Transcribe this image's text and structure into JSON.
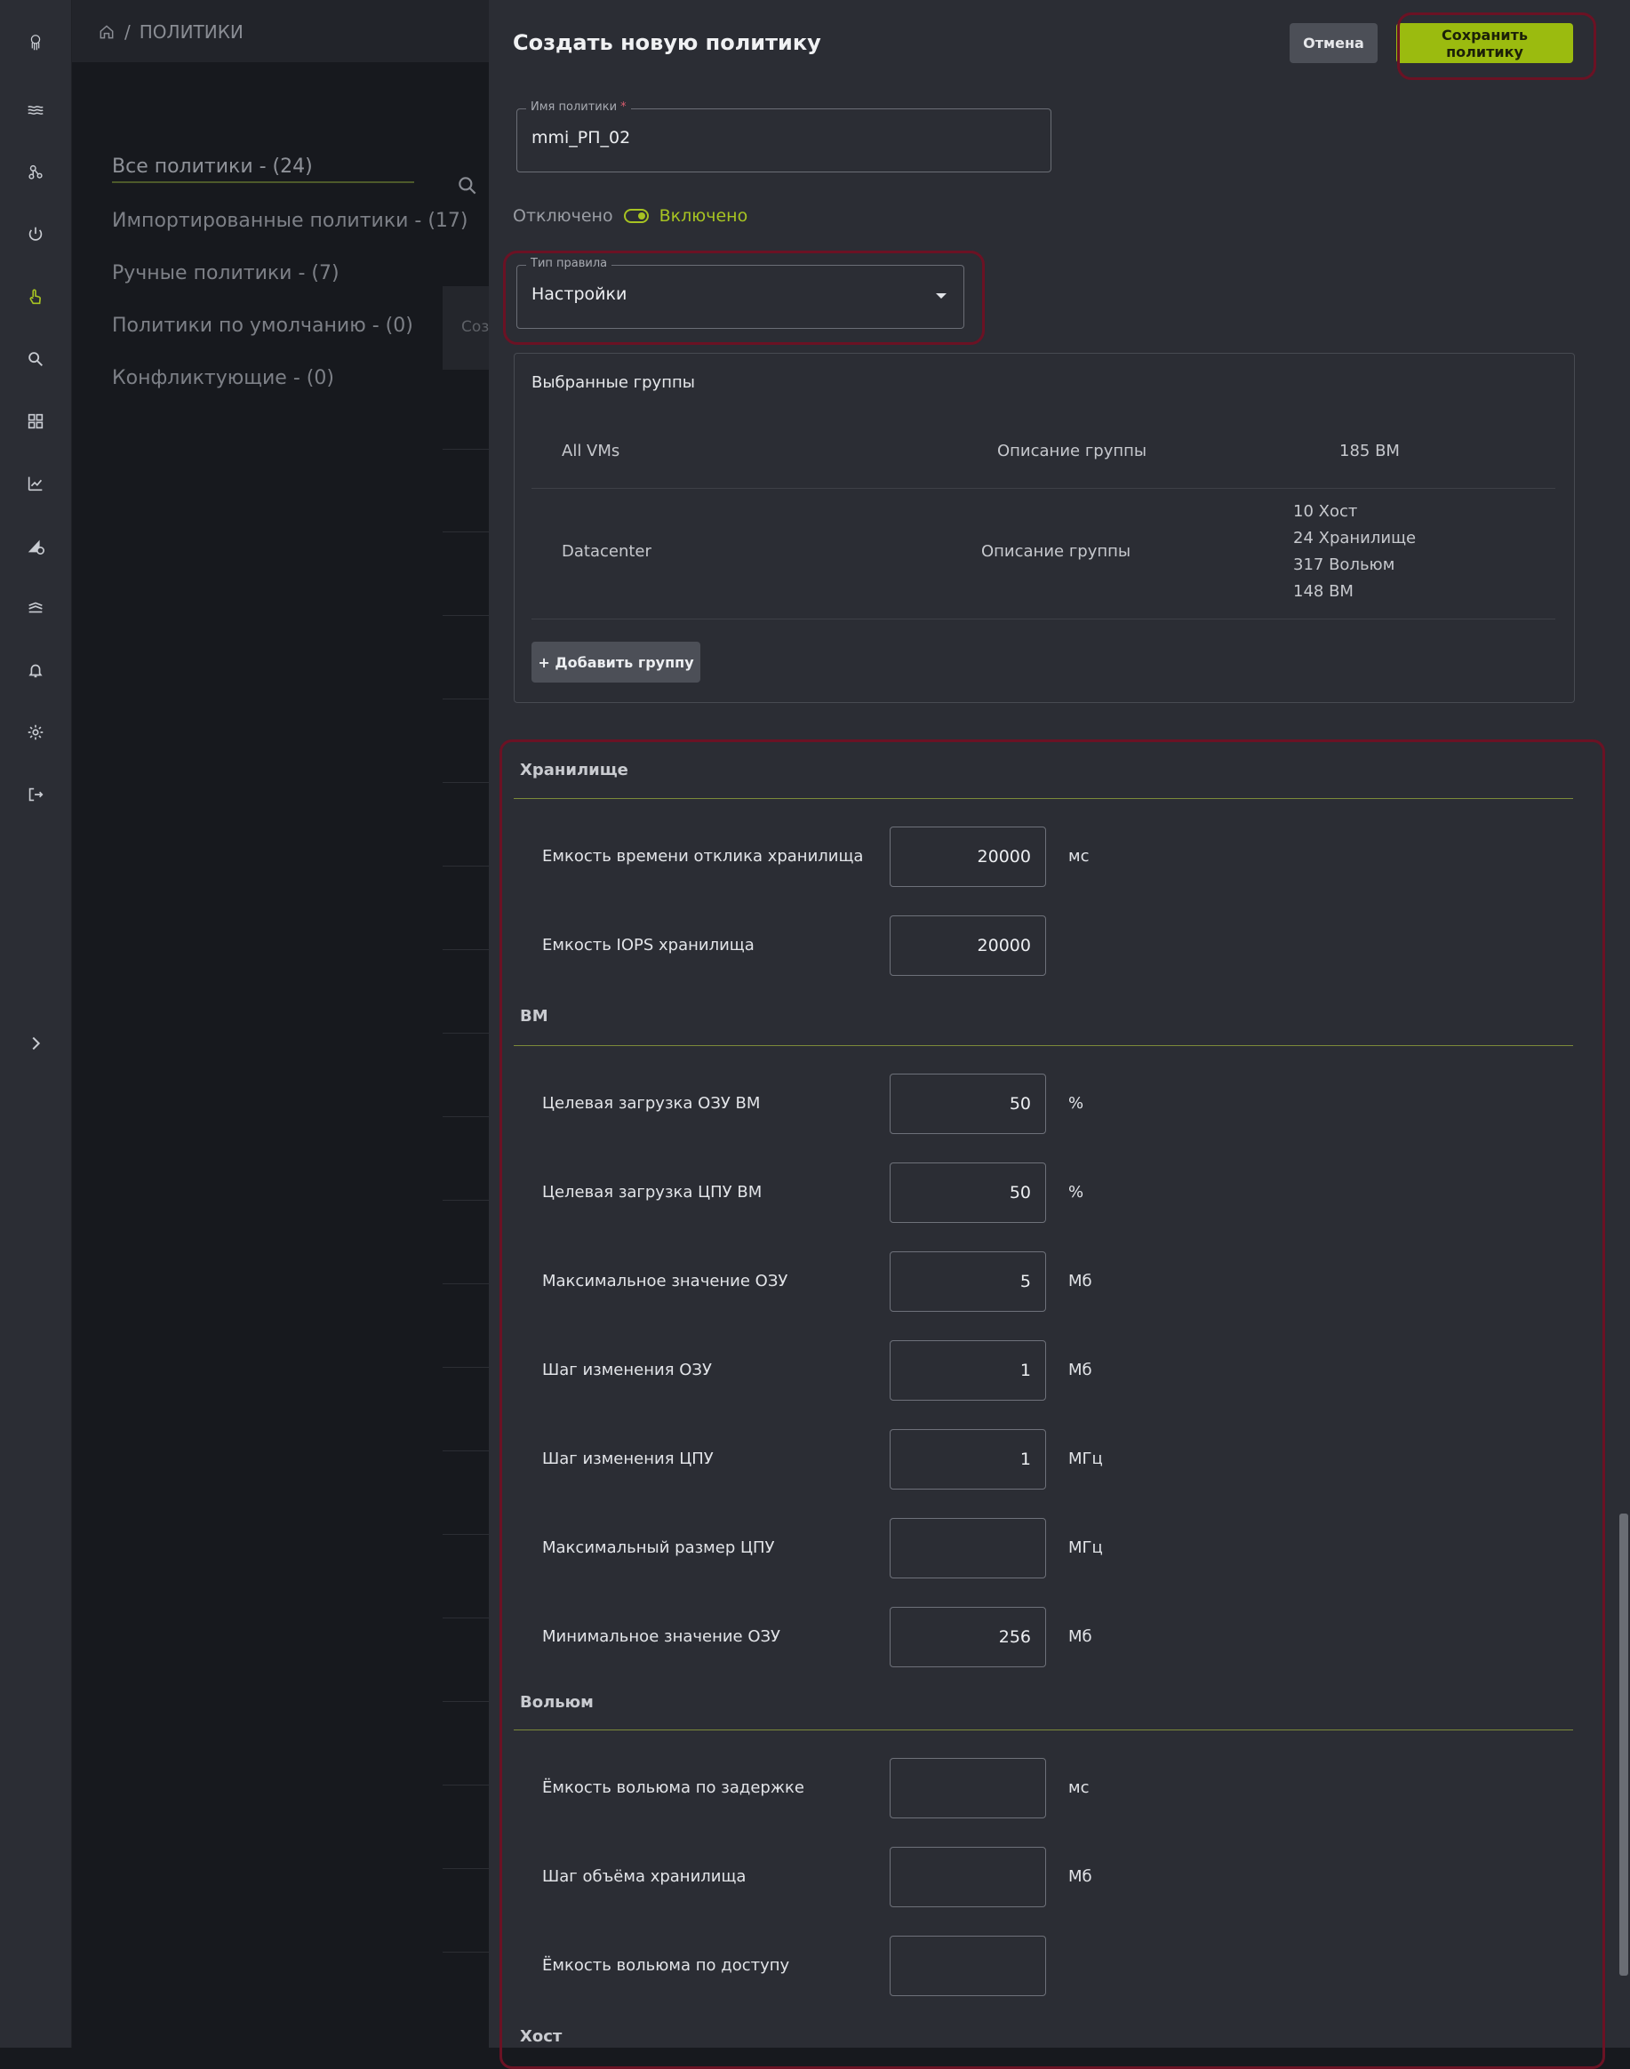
{
  "breadcrumb": {
    "page": "ПОЛИТИКИ"
  },
  "filters": [
    "Все политики - (24)",
    "Импортированные политики - (17)",
    "Ручные политики - (7)",
    "Политики по умолчанию - (0)",
    "Конфликтующие - (0)"
  ],
  "background_table": {
    "header_fragment": "Соз"
  },
  "drawer": {
    "title": "Создать новую политику",
    "cancel_label": "Отмена",
    "save_label": "Сохранить политику",
    "policy_name": {
      "label": "Имя политики",
      "required_mark": "*",
      "value": "mmi_РП_02"
    },
    "toggle": {
      "off_label": "Отключено",
      "on_label": "Включено",
      "state": "on"
    },
    "rule_type": {
      "label": "Тип правила",
      "value": "Настройки"
    },
    "groups": {
      "title": "Выбранные группы",
      "rows": [
        {
          "name": "All VMs",
          "description": "Описание группы",
          "counts": [
            "185 ВМ"
          ]
        },
        {
          "name": "Datacenter",
          "description": "Описание группы",
          "counts": [
            "10 Хост",
            "24 Хранилище",
            "317 Вольюм",
            "148 ВМ"
          ]
        }
      ],
      "add_label": "+ Добавить группу"
    },
    "sections": [
      {
        "title": "Хранилище",
        "params": [
          {
            "label": "Емкость времени отклика хранилища",
            "value": "20000",
            "unit": "мс"
          },
          {
            "label": "Емкость IOPS хранилища",
            "value": "20000",
            "unit": ""
          }
        ]
      },
      {
        "title": "ВМ",
        "params": [
          {
            "label": "Целевая загрузка ОЗУ ВМ",
            "value": "50",
            "unit": "%"
          },
          {
            "label": "Целевая загрузка ЦПУ ВМ",
            "value": "50",
            "unit": "%"
          },
          {
            "label": "Максимальное значение ОЗУ",
            "value": "5",
            "unit": "Мб"
          },
          {
            "label": "Шаг изменения ОЗУ",
            "value": "1",
            "unit": "Мб"
          },
          {
            "label": "Шаг изменения ЦПУ",
            "value": "1",
            "unit": "МГц"
          },
          {
            "label": "Максимальный размер ЦПУ",
            "value": "",
            "unit": "МГц"
          },
          {
            "label": "Минимальное значение ОЗУ",
            "value": "256",
            "unit": "Мб"
          }
        ]
      },
      {
        "title": "Вольюм",
        "params": [
          {
            "label": "Ёмкость вольюма по задержке",
            "value": "",
            "unit": "мс"
          },
          {
            "label": "Шаг объёма хранилища",
            "value": "",
            "unit": "Мб"
          },
          {
            "label": "Ёмкость вольюма по доступу",
            "value": "",
            "unit": ""
          }
        ]
      },
      {
        "title": "Хост",
        "params": []
      }
    ]
  },
  "colors": {
    "accent": "#9bbb0f",
    "toggle_on": "#a7c322",
    "highlight_ring": "#6b1224"
  },
  "icons": [
    "logo-icon",
    "waves-icon",
    "nodes-icon",
    "power-icon",
    "hand-pointer-icon",
    "search-icon",
    "dashboard-icon",
    "chart-icon",
    "ruler-gear-icon",
    "layers-icon",
    "bell-icon",
    "gear-icon",
    "logout-icon",
    "chevron-right-icon",
    "home-icon",
    "dropdown-caret-icon"
  ]
}
